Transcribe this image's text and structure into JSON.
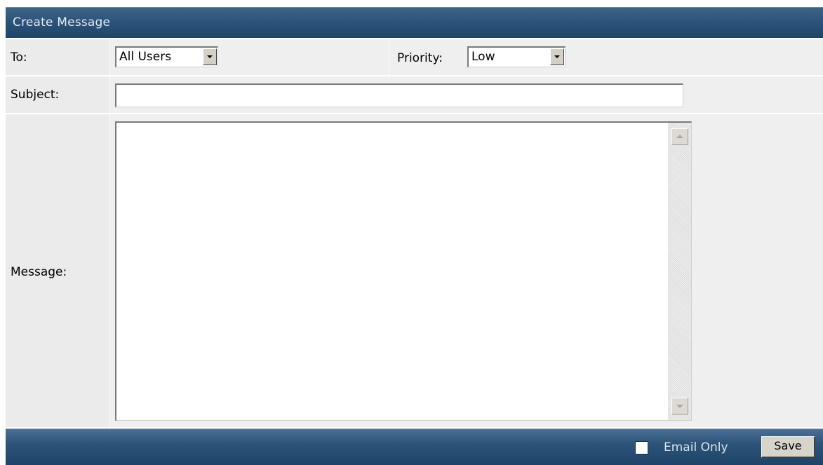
{
  "header": {
    "title": "Create Message"
  },
  "to": {
    "label": "To:",
    "selected": "All Users"
  },
  "priority": {
    "label": "Priority:",
    "selected": "Low"
  },
  "subject": {
    "label": "Subject:",
    "value": ""
  },
  "message": {
    "label": "Message:",
    "value": ""
  },
  "footer": {
    "email_only_label": "Email Only",
    "email_only_checked": false,
    "save_label": "Save"
  },
  "icons": [
    "chevron-down-icon",
    "scroll-up-arrow-icon",
    "scroll-down-arrow-icon"
  ],
  "colors": {
    "header_bar": "#2c5379",
    "row_background": "#efefef",
    "label_background": "#ebebeb"
  }
}
